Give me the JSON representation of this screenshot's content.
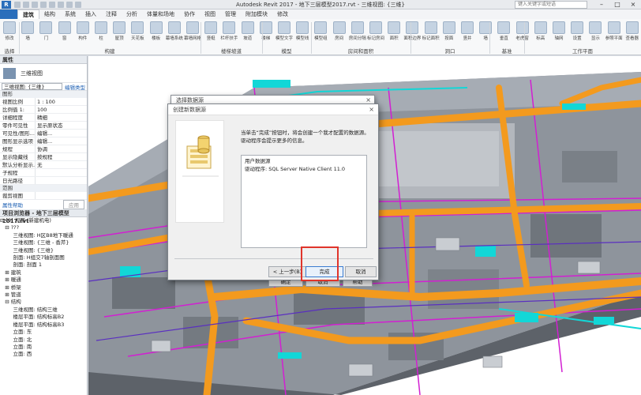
{
  "window": {
    "title": "Autodesk Revit 2017 -    地下三层模型2017.rvt - 三维视图: {三维}",
    "search_placeholder": "键入关键字或短语",
    "app_logo": "R"
  },
  "ribbon": {
    "tabs": [
      "建筑",
      "结构",
      "系统",
      "插入",
      "注释",
      "分析",
      "体量和场地",
      "协作",
      "视图",
      "管理",
      "附加模块",
      "修改"
    ],
    "active_tab": "建筑",
    "tools": [
      "修改",
      "墙",
      "门",
      "窗",
      "构件",
      "柱",
      "屋顶",
      "天花板",
      "楼板",
      "幕墙系统",
      "幕墙网格",
      "竖梃",
      "栏杆扶手",
      "坡道",
      "楼梯",
      "模型文字",
      "模型线",
      "模型组",
      "房间",
      "房间分隔",
      "标记房间",
      "面积",
      "面积边界",
      "标记面积",
      "按面",
      "竖井",
      "墙",
      "垂直",
      "老虎窗",
      "标高",
      "轴网",
      "设置",
      "显示",
      "参照平面",
      "查看器"
    ],
    "panels": [
      "选择",
      "构建",
      "楼梯坡道",
      "模型",
      "房间和面积",
      "洞口",
      "基准",
      "工作平面"
    ]
  },
  "properties": {
    "header": "属性",
    "type_name": "三维视图",
    "selector_value": "三维视图: {三维}",
    "edit_type": "编辑类型",
    "group_graphics": "图形",
    "rows": [
      {
        "k": "视图比例",
        "v": "1 : 100"
      },
      {
        "k": "比例值 1:",
        "v": "100"
      },
      {
        "k": "详细程度",
        "v": "精细"
      },
      {
        "k": "零件可见性",
        "v": "显示原状态"
      },
      {
        "k": "可见性/图形...",
        "v": "编辑..."
      },
      {
        "k": "图形显示选项",
        "v": "编辑..."
      },
      {
        "k": "规程",
        "v": "协调"
      },
      {
        "k": "显示隐藏线",
        "v": "按规程"
      },
      {
        "k": "默认分析显示...",
        "v": "无"
      },
      {
        "k": "子规程",
        "v": ""
      },
      {
        "k": "日光路径",
        "v": ""
      }
    ],
    "group_range": "范围",
    "range_rows": [
      {
        "k": "裁剪视图",
        "v": ""
      }
    ],
    "help_link": "属性帮助",
    "apply": "应用"
  },
  "browser": {
    "header": "项目浏览器 - 地下三层模型2017.rvt",
    "items": [
      "⊟ [0] 视图 (新建机电)",
      "   ⊟ ???",
      "        三维视图: H区B8地下暖通",
      "        三维视图: {三维 - 香芹}",
      "        三维视图: {三维}",
      "        剖面: H组交7轴剖面图",
      "        剖面: 剖面 1",
      "   ⊞ 建筑",
      "   ⊞ 暖通",
      "   ⊞ 桥架",
      "   ⊞ 管道",
      "   ⊟ 结构",
      "        三维视图: 结构三维",
      "        楼层平面: 结构标高B2",
      "        楼层平面: 结构标高B3",
      "        立面: 东",
      "        立面: 北",
      "        立面: 南",
      "        立面: 西"
    ]
  },
  "dialog_back": {
    "title": "选择数据源",
    "buttons": [
      "确定",
      "取消",
      "帮助"
    ]
  },
  "dialog": {
    "title": "创建新数据源",
    "message": "当单击“完成”按钮时，将会创建一个我才配置的数据源。驱动程序会提示更多的信息。",
    "detail_line1": "用户数据源",
    "detail_line2": "驱动程序:  SQL Server Native Client 11.0",
    "back": "< 上一步(B)",
    "finish": "完成",
    "cancel": "取消"
  },
  "colors": {
    "duct_orange": "#f39a1e",
    "pipe_cyan": "#12d7d7",
    "cable_magenta": "#d21fd2",
    "floor_gray": "#858b93",
    "highlight_red": "#e0342b"
  }
}
